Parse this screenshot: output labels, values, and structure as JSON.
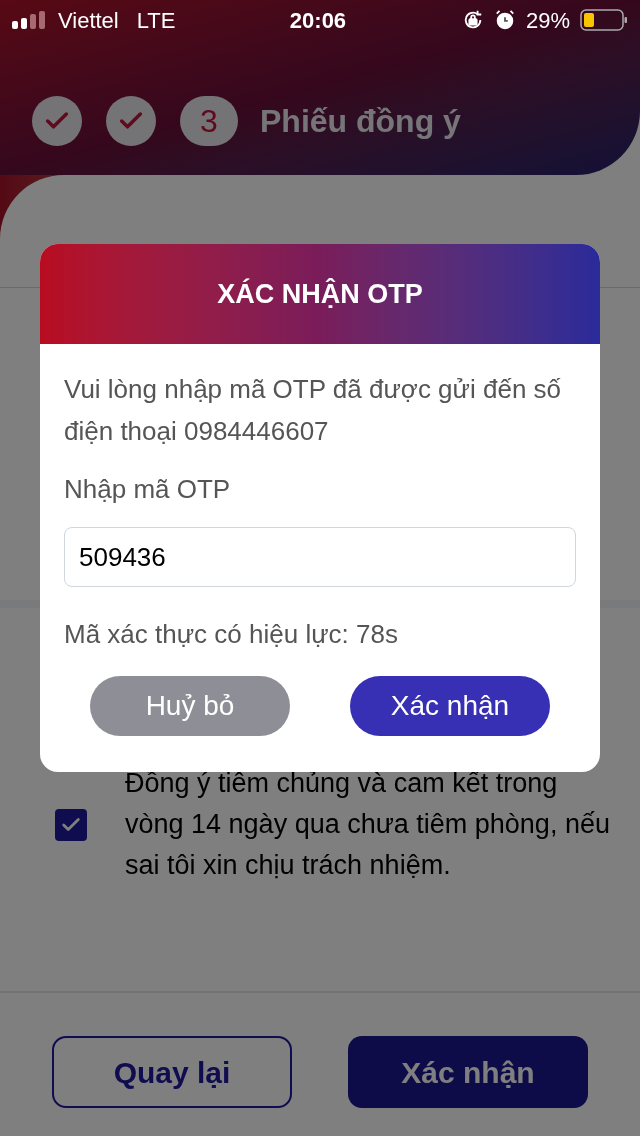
{
  "status_bar": {
    "carrier": "Viettel",
    "network": "LTE",
    "time": "20:06",
    "battery": "29%"
  },
  "stepper": {
    "steps": [
      {
        "kind": "done"
      },
      {
        "kind": "done"
      },
      {
        "kind": "current",
        "label": "3"
      }
    ],
    "title": "Phiếu đồng ý"
  },
  "background": {
    "consent": {
      "checked": true,
      "text": "Đồng ý tiêm chủng và cam kết trong vòng 14 ngày qua chưa tiêm phòng, nếu sai tôi xin chịu trách nhiệm."
    },
    "buttons": [
      {
        "label": "Quay lại",
        "kind": "outline"
      },
      {
        "label": "Xác nhận",
        "kind": "filled"
      }
    ]
  },
  "dialog": {
    "title": "XÁC NHẬN OTP",
    "message": "Vui lòng nhập mã OTP đã được gửi đến số điện thoại 0984446607",
    "field_label": "Nhập mã OTP",
    "otp_value": "509436",
    "validity": "Mã xác thực có hiệu lực: 78s",
    "buttons": [
      {
        "label": "Huỷ bỏ",
        "kind": "cancel"
      },
      {
        "label": "Xác nhận",
        "kind": "confirm"
      }
    ]
  }
}
